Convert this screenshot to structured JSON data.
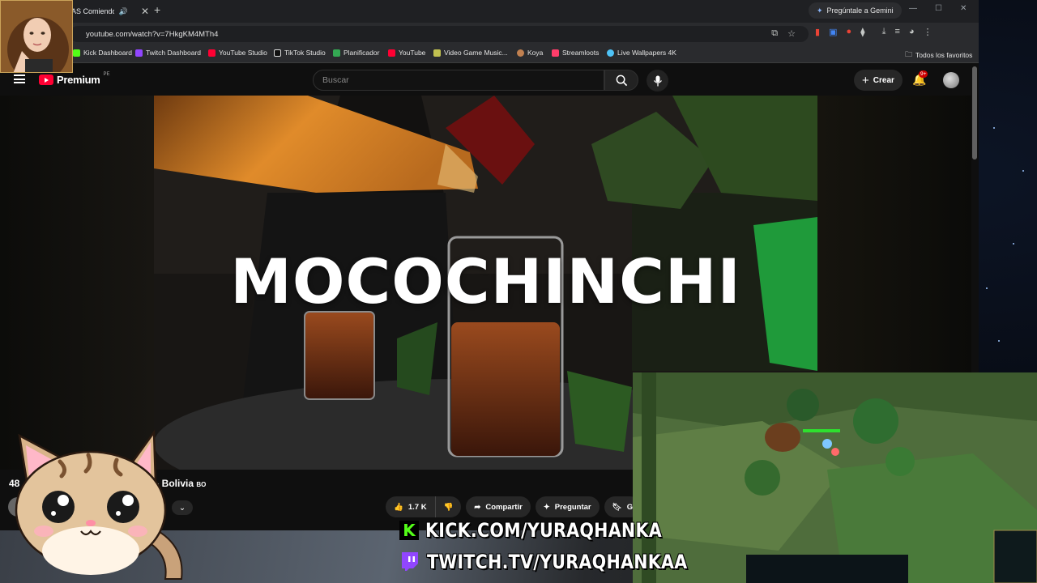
{
  "browser": {
    "tab_title": "AS Comiendo e",
    "new_tab_symbol": "+",
    "gemini_label": "Pregúntale a Gemini",
    "url": "youtube.com/watch?v=7HkgKM4MTh4",
    "bookmarks": [
      {
        "label": "Kick Dashboard",
        "color": "#53fc18"
      },
      {
        "label": "Twitch Dashboard",
        "color": "#9146ff"
      },
      {
        "label": "YouTube Studio",
        "color": "#ff0033"
      },
      {
        "label": "TikTok Studio",
        "color": "#ffffff"
      },
      {
        "label": "Planificador",
        "color": "#34a853"
      },
      {
        "label": "YouTube",
        "color": "#ff0033"
      },
      {
        "label": "Video Game Music...",
        "color": "#c0c050"
      },
      {
        "label": "Koya",
        "color": "#c08050"
      },
      {
        "label": "Streamloots",
        "color": "#ff3d6a"
      },
      {
        "label": "Live Wallpapers 4K",
        "color": "#4fc3f7"
      }
    ],
    "all_bookmarks_label": "Todos los favoritos"
  },
  "youtube": {
    "logo_text": "Premium",
    "logo_country": "PE",
    "search_placeholder": "Buscar",
    "create_label": "Crear",
    "notifications_badge": "9+",
    "video_overlay_title": "MOCOCHINCHI",
    "title_left": "48",
    "title_right": "z - Bolivia",
    "title_country": "BO",
    "likes": "1.7 K",
    "share_label": "Compartir",
    "ask_label": "Preguntar",
    "save_label_partial": "G"
  },
  "overlay": {
    "kick_text": "KICK.COM/YURAQHANKA",
    "twitch_text": "TWITCH.TV/YURAQHANKAA",
    "kick_color": "#53fc18",
    "twitch_color": "#9146ff"
  }
}
